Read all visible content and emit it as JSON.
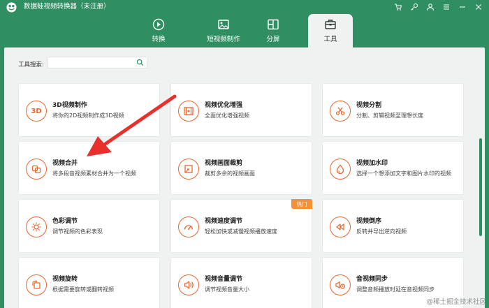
{
  "app": {
    "title": "数据蛙视频转换器（未注册）",
    "logo_icon": "frog-logo-icon"
  },
  "window_controls": [
    {
      "name": "cart-icon"
    },
    {
      "name": "key-icon"
    },
    {
      "name": "user-icon"
    },
    {
      "name": "menu-icon"
    },
    {
      "name": "minimize-icon"
    },
    {
      "name": "close-icon"
    }
  ],
  "tabs": [
    {
      "label": "转换",
      "icon": "convert-icon",
      "active": false
    },
    {
      "label": "短视频制作",
      "icon": "image-icon",
      "active": false
    },
    {
      "label": "分屏",
      "icon": "split-screen-icon",
      "active": false
    },
    {
      "label": "工具",
      "icon": "toolbox-icon",
      "active": true
    }
  ],
  "search": {
    "label": "工具搜索:",
    "value": "",
    "placeholder": ""
  },
  "tools": [
    {
      "title": "3D视频制作",
      "desc": "将你的2D视频制作成3D视频",
      "icon": "3d-icon"
    },
    {
      "title": "视频优化增强",
      "desc": "全面优化增强视频",
      "icon": "film-enhance-icon"
    },
    {
      "title": "视频分割",
      "desc": "分割、剪辑视频至理想长度",
      "icon": "scissors-icon"
    },
    {
      "title": "视频合并",
      "desc": "将多段音视频素材合并为一个视频",
      "icon": "merge-icon"
    },
    {
      "title": "视频画面裁剪",
      "desc": "裁剪多余的视频画面",
      "icon": "crop-icon"
    },
    {
      "title": "视频加水印",
      "desc": "选择一个想添加文字和图片水印的视频",
      "icon": "watermark-drop-icon"
    },
    {
      "title": "色彩调节",
      "desc": "调节视频的色彩表现",
      "icon": "sun-icon"
    },
    {
      "title": "视频速度调节",
      "desc": "轻松加快或减慢视频播放速度",
      "icon": "speedometer-icon",
      "badge": "热门"
    },
    {
      "title": "视频倒序",
      "desc": "反转并导出逆向视频",
      "icon": "rewind-icon"
    },
    {
      "title": "视频旋转",
      "desc": "根据需要旋转或翻转视频",
      "icon": "rotate-icon"
    },
    {
      "title": "视频音量调节",
      "desc": "调节视频音量大小",
      "icon": "volume-icon"
    },
    {
      "title": "音视频同步",
      "desc": "调整音频播放时延在音视频同步",
      "icon": "av-sync-icon"
    }
  ],
  "watermark": "@稀土掘金技术社区",
  "colors": {
    "brand_green": "#2f8f63",
    "accent_orange": "#e9662c",
    "badge_orange": "#f39136",
    "arrow_red": "#e8302c"
  }
}
